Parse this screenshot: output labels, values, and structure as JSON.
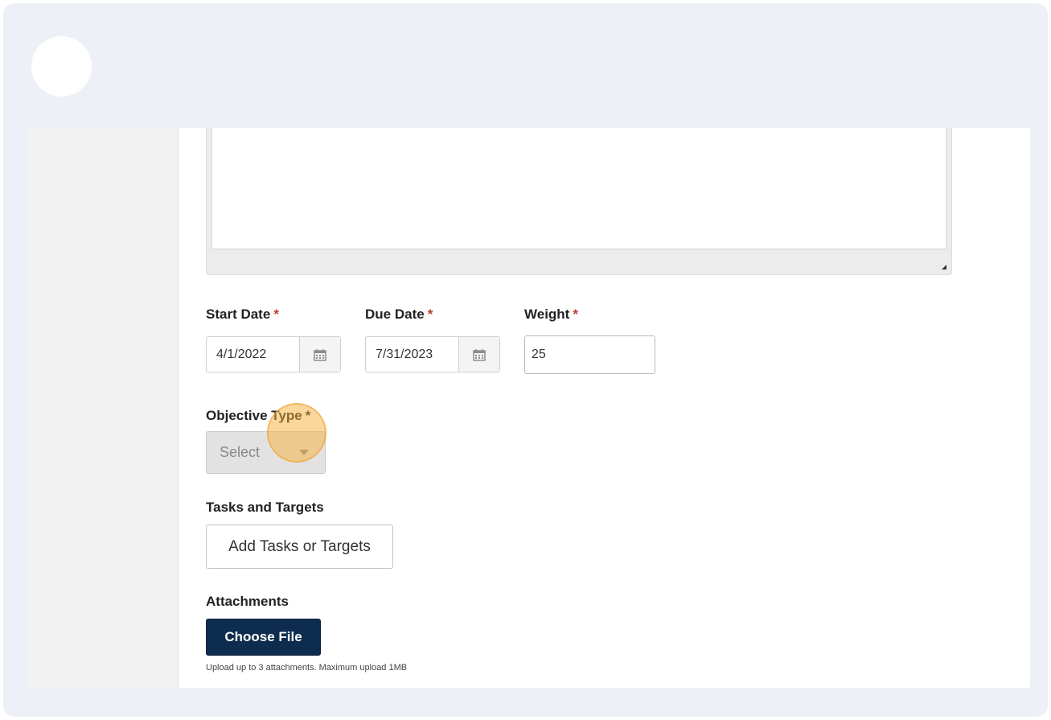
{
  "form": {
    "start_date": {
      "label": "Start Date",
      "required_mark": "*",
      "value": "4/1/2022"
    },
    "due_date": {
      "label": "Due Date",
      "required_mark": "*",
      "value": "7/31/2023"
    },
    "weight": {
      "label": "Weight",
      "required_mark": "*",
      "value": "25"
    },
    "objective_type": {
      "label": "Objective Type",
      "required_mark": "*",
      "selected": "Select"
    },
    "tasks": {
      "label": "Tasks and Targets",
      "button_label": "Add Tasks or Targets"
    },
    "attachments": {
      "label": "Attachments",
      "button_label": "Choose File",
      "hint": "Upload up to 3 attachments. Maximum upload 1MB"
    }
  },
  "icons": {
    "calendar": "calendar-icon",
    "dropdown": "chevron-down-icon",
    "resize": "resize-handle-icon"
  },
  "colors": {
    "primary_button": "#0e2c4e",
    "required": "#c0392b",
    "highlight": "#f6b13c",
    "frame": "#eef0f7"
  }
}
